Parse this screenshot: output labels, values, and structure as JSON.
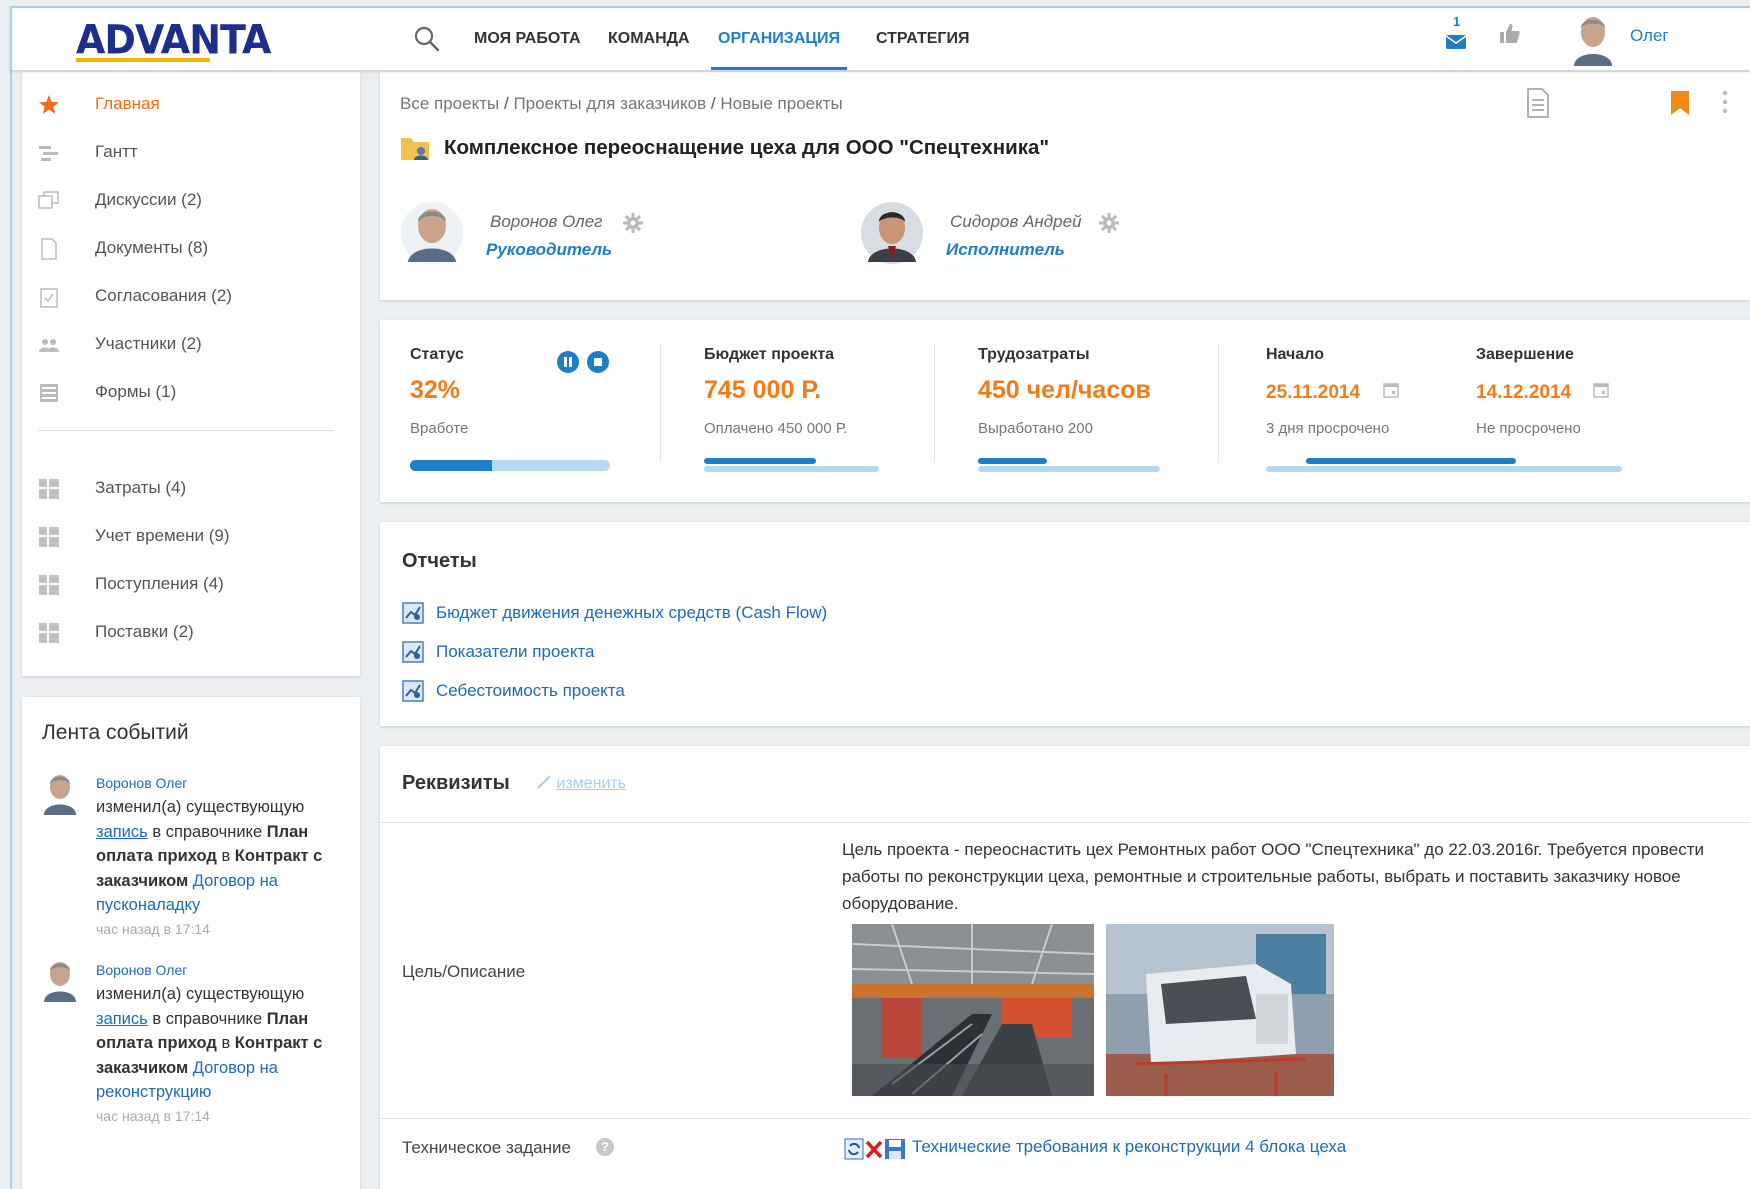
{
  "brand": {
    "logo_text": "ADVANTA",
    "accent": "#1e7ec8",
    "orange": "#f07c1c"
  },
  "topnav": {
    "items": [
      {
        "label": "МОЯ РАБОТА"
      },
      {
        "label": "КОМАНДА"
      },
      {
        "label": "ОРГАНИЗАЦИЯ",
        "active": true
      },
      {
        "label": "СТРАТЕГИЯ"
      }
    ],
    "mail_count": "1",
    "user_name": "Олег"
  },
  "sidebar": {
    "items": [
      {
        "label": "Главная",
        "icon": "star-icon"
      },
      {
        "label": "Гантт",
        "icon": "gantt-icon"
      },
      {
        "label": "Дискуссии (2)",
        "icon": "discussion-icon"
      },
      {
        "label": "Документы (8)",
        "icon": "document-icon"
      },
      {
        "label": "Согласования (2)",
        "icon": "approval-icon"
      },
      {
        "label": "Участники (2)",
        "icon": "participants-icon"
      },
      {
        "label": "Формы (1)",
        "icon": "forms-icon"
      },
      {
        "label": "Затраты (4)",
        "icon": "table-icon"
      },
      {
        "label": "Учет времени (9)",
        "icon": "table-icon"
      },
      {
        "label": "Поступления (4)",
        "icon": "table-icon"
      },
      {
        "label": "Поставки (2)",
        "icon": "table-icon"
      }
    ]
  },
  "feed": {
    "title": "Лента событий",
    "entries": [
      {
        "author": "Воронов Олег",
        "text_1": "изменил(а) существующую",
        "link_1": "запись",
        "text_2": "в справочнике",
        "text_3": "План оплата приход",
        "text_4": "в",
        "text_5": "Контракт с заказчиком",
        "link_2": "Договор на пусконаладку",
        "time": "час назад в 17:14"
      },
      {
        "author": "Воронов Олег",
        "text_1": "изменил(а) существующую",
        "link_1": "запись",
        "text_2": "в справочнике",
        "text_3": "План оплата приход",
        "text_4": "в",
        "text_5": "Контракт с заказчиком",
        "link_2": "Договор на реконструкцию",
        "time": "час назад в 17:14"
      }
    ]
  },
  "project": {
    "breadcrumb": [
      "Все проекты",
      "Проекты для заказчиков",
      "Новые проекты"
    ],
    "breadcrumb_sep": "/",
    "title": "Комплексное переоснащение цеха для ООО \"Спецтехника\"",
    "people": [
      {
        "name": "Воронов Олег",
        "role": "Руководитель"
      },
      {
        "name": "Сидоров Андрей",
        "role": "Исполнитель"
      }
    ]
  },
  "metrics": {
    "status": {
      "label": "Статус",
      "value": "32%",
      "sub": "Вработе",
      "progress": 0.41
    },
    "budget": {
      "label": "Бюджет проекта",
      "value": "745 000 Р.",
      "sub": "Оплачено 450 000 Р.",
      "progress": 0.64
    },
    "labor": {
      "label": "Трудозатраты",
      "value": "450 чел/часов",
      "sub": "Выработано 200",
      "progress": 0.38
    },
    "start": {
      "label": "Начало",
      "value": "25.11.2014",
      "sub": "3 дня просрочено"
    },
    "end": {
      "label": "Завершение",
      "value": "14.12.2014",
      "sub": "Не просрочено"
    },
    "timeline_progress": 0.59
  },
  "reports": {
    "title": "Отчеты",
    "links": [
      "Бюджет движения денежных средств (Cash Flow)",
      "Показатели проекта",
      "Себестоимость проекта"
    ]
  },
  "requisites": {
    "title": "Реквизиты",
    "edit_label": "изменить",
    "goal_label": "Цель/Описание",
    "goal_text": "Цель  проекта  - переоснастить цех Ремонтных работ ООО \"Спецтехника\" до 22.03.2016г. Требуется провести работы по реконструкции цеха, ремонтные и строительные работы, выбрать и поставить заказчику новое оборудование.",
    "tz_label": "Техническое задание",
    "tz_help": "?",
    "tz_link": "Технические требования к реконструкции 4 блока цеха"
  }
}
